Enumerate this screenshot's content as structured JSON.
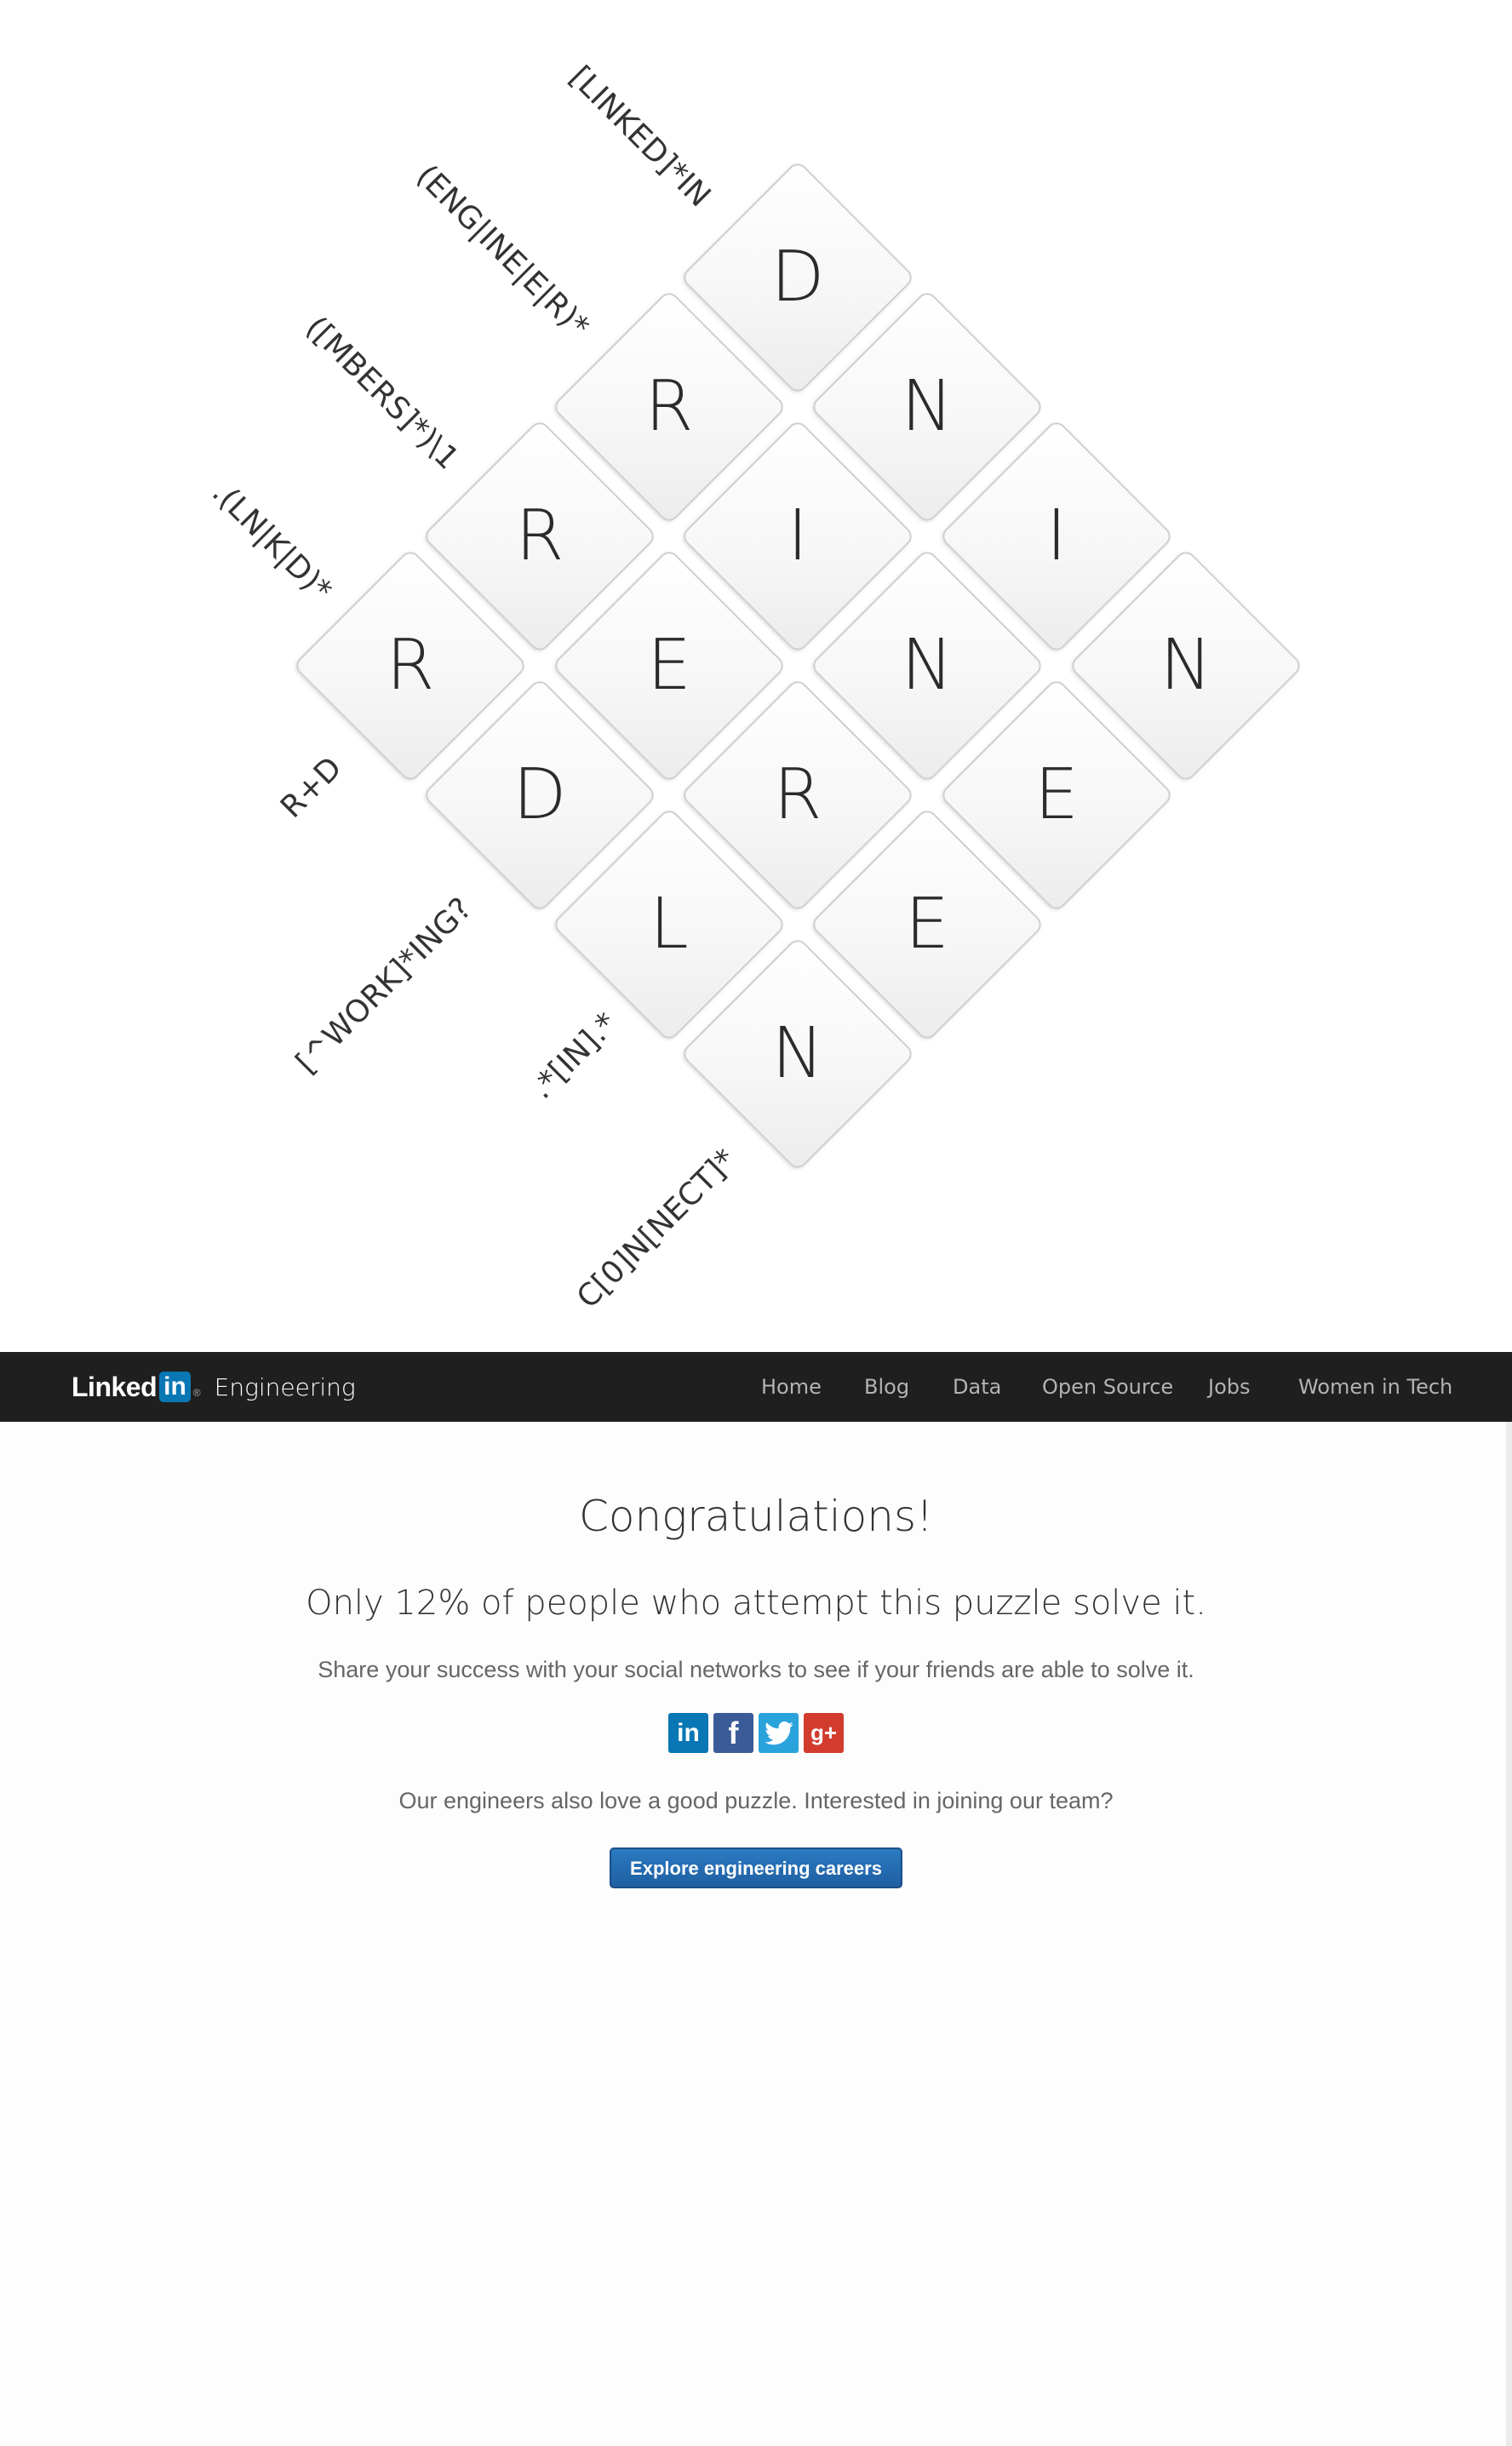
{
  "puzzle": {
    "cells": [
      {
        "letter": "D"
      },
      {
        "letter": "R"
      },
      {
        "letter": "N"
      },
      {
        "letter": "R"
      },
      {
        "letter": "I"
      },
      {
        "letter": "I"
      },
      {
        "letter": "R"
      },
      {
        "letter": "E"
      },
      {
        "letter": "N"
      },
      {
        "letter": "N"
      },
      {
        "letter": "D"
      },
      {
        "letter": "R"
      },
      {
        "letter": "E"
      },
      {
        "letter": "L"
      },
      {
        "letter": "E"
      },
      {
        "letter": "N"
      }
    ],
    "clues": [
      "[LINKED]*IN",
      "(ENG|INE|E|R)*",
      "([MBERS]*)\\1",
      ".(LN|K|D)*",
      "R+D",
      "[^WORK]*ING?",
      ".*[IN].*",
      "C[0]N[NECT]*"
    ]
  },
  "navbar": {
    "logo_linked": "Linked",
    "logo_in": "in",
    "logo_reg": "®",
    "logo_engineering": "Engineering",
    "items": [
      "Home",
      "Blog",
      "Data",
      "Open Source",
      "Jobs",
      "Women in Tech"
    ]
  },
  "content": {
    "title": "Congratulations!",
    "stat": "Only 12% of people who attempt this puzzle solve it.",
    "share_text": "Share your success with your social networks to see if your friends are able to solve it.",
    "social": [
      {
        "icon": "linkedin-icon",
        "glyph": "in",
        "color": "#0a77b5"
      },
      {
        "icon": "facebook-icon",
        "glyph": "f",
        "color": "#3b5b98"
      },
      {
        "icon": "twitter-icon",
        "glyph": "t",
        "color": "#2aa3dc"
      },
      {
        "icon": "google-plus-icon",
        "glyph": "g+",
        "color": "#d23c2f"
      }
    ],
    "team_text": "Our engineers also love a good puzzle. Interested in joining our team?",
    "careers_button": "Explore engineering careers"
  }
}
